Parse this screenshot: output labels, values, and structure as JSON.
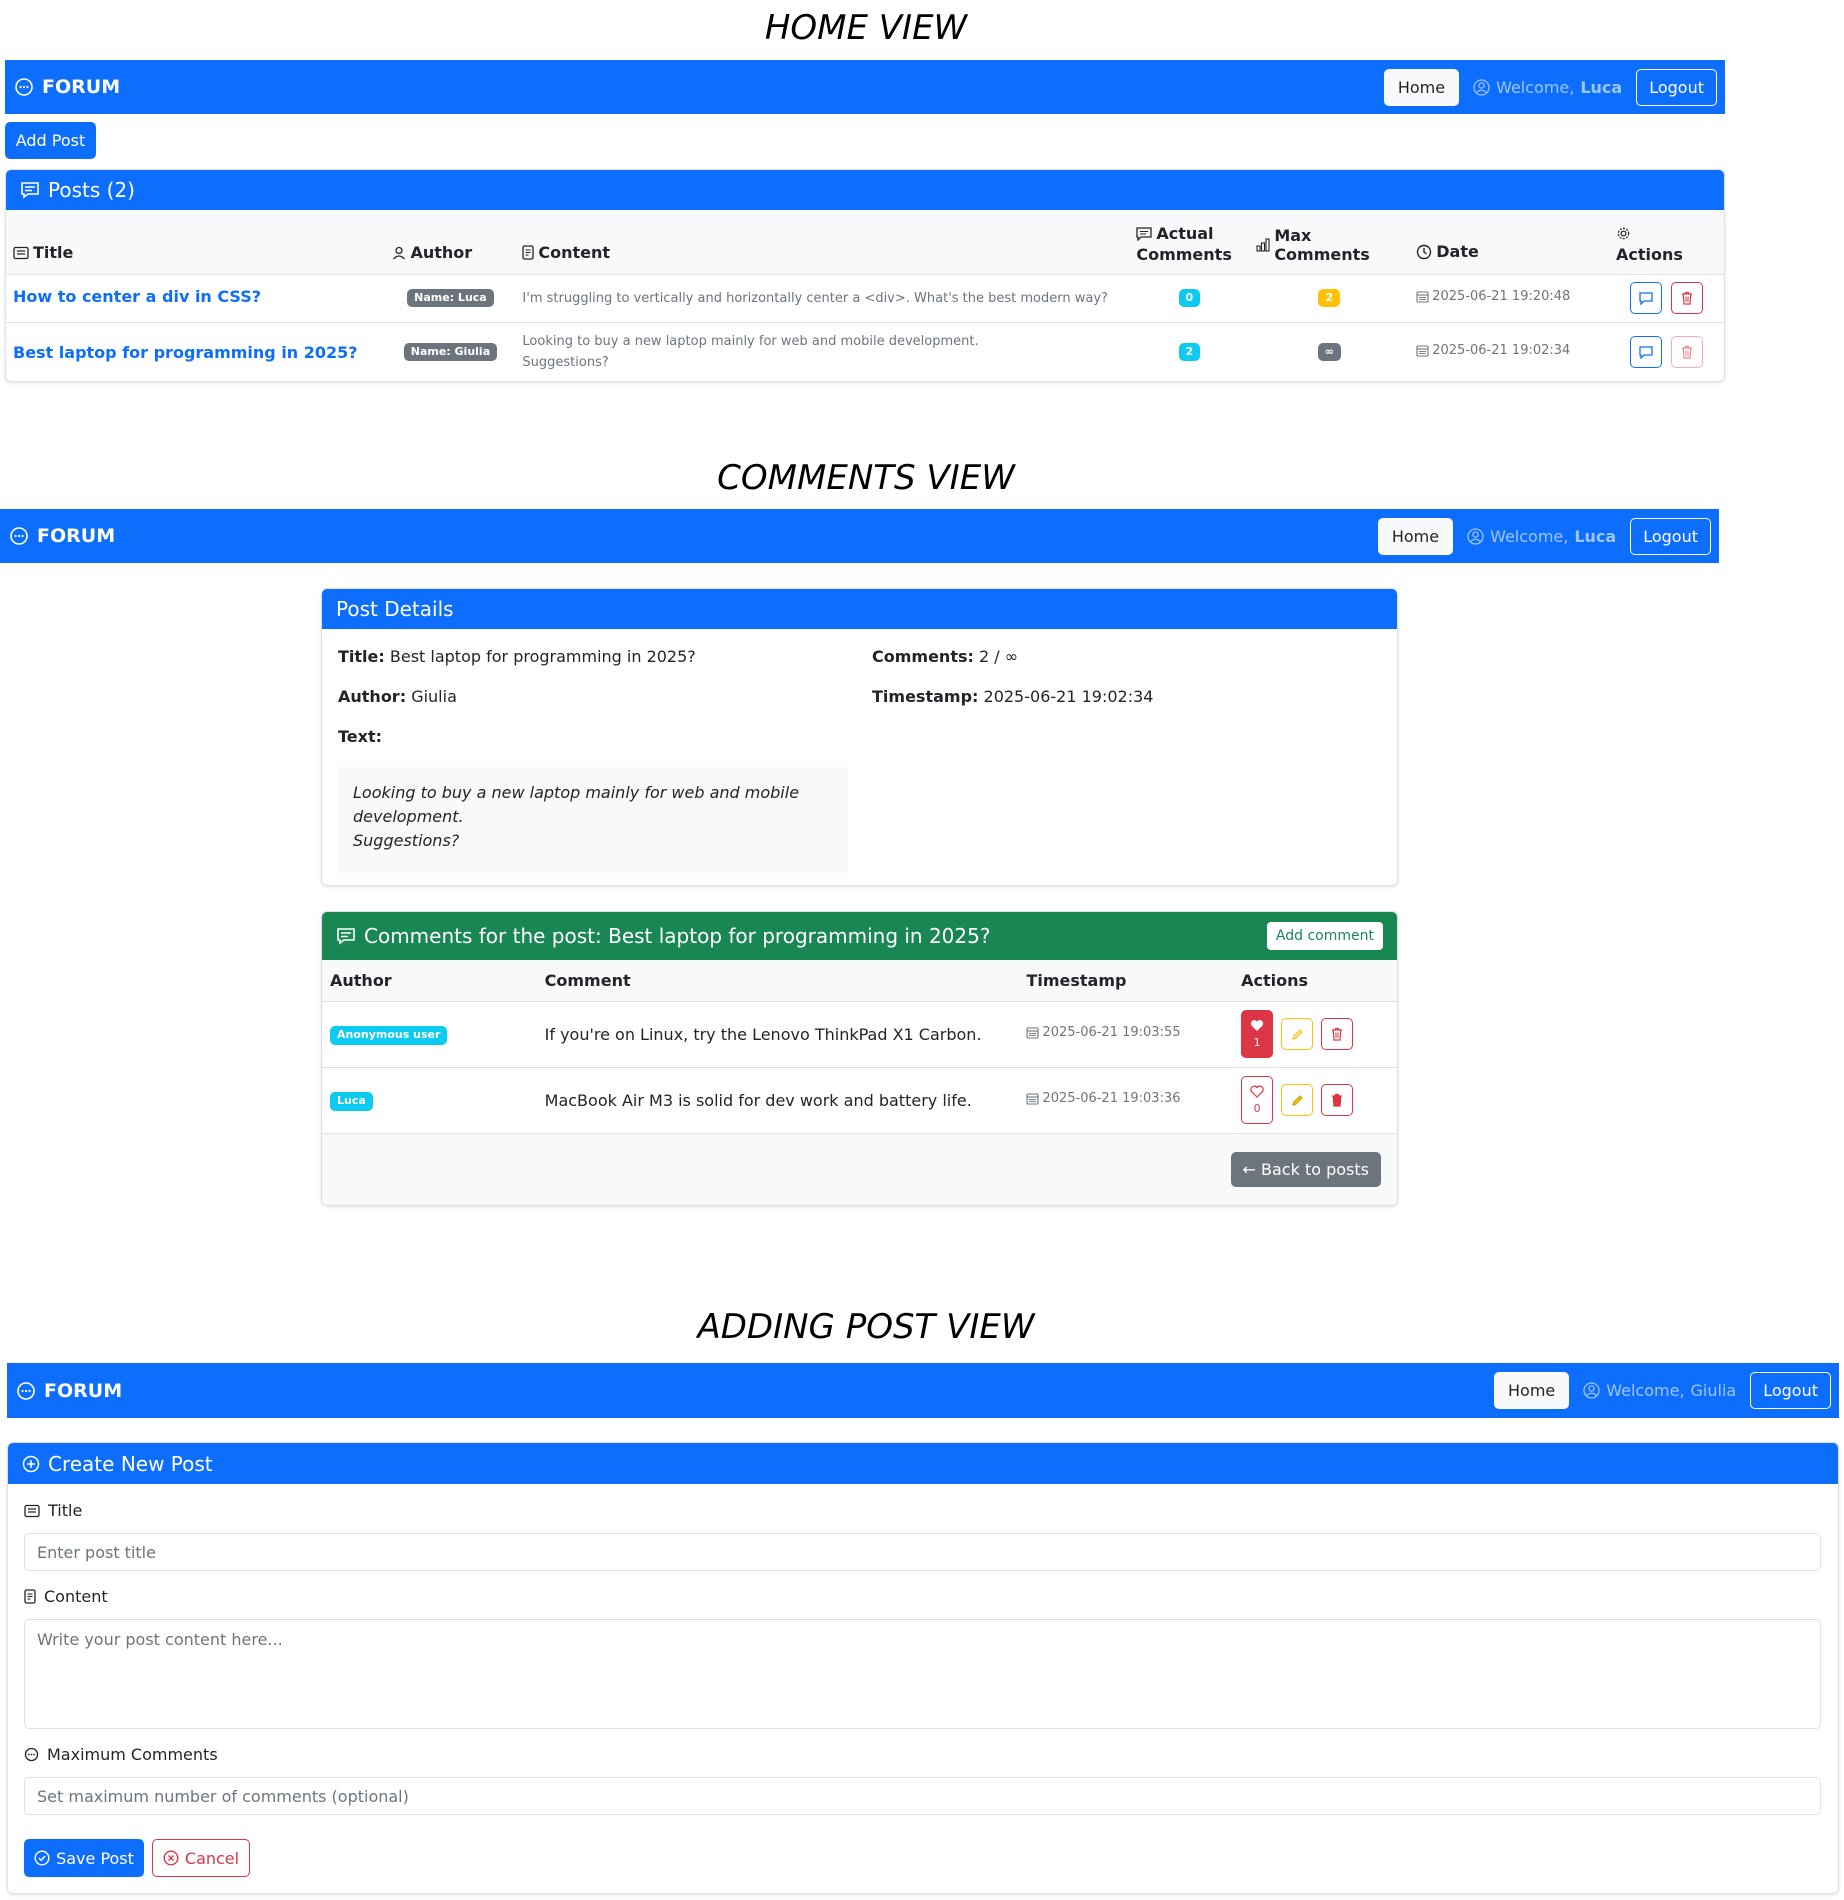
{
  "view_titles": {
    "home": "HOME VIEW",
    "comments": "COMMENTS VIEW",
    "adding": "ADDING POST VIEW"
  },
  "navbar": {
    "brand": "FORUM",
    "home_label": "Home",
    "welcome_prefix": "Welcome,",
    "logout_label": "Logout"
  },
  "home": {
    "user": "Luca",
    "add_post_label": "Add Post",
    "posts_header": "Posts (2)",
    "columns": {
      "title": "Title",
      "author": "Author",
      "content": "Content",
      "actual_comments_1": "Actual",
      "actual_comments_2": "Comments",
      "max_comments": "Max Comments",
      "date": "Date",
      "actions": "Actions"
    },
    "posts": [
      {
        "title": "How to center a div in CSS?",
        "author": "Name: Luca",
        "content": "I'm struggling to vertically and horizontally center a <div>. What's the best modern way?",
        "actual_comments": "0",
        "max_comments": "2",
        "date": "2025-06-21 19:20:48"
      },
      {
        "title": "Best laptop for programming in 2025?",
        "author": "Name: Giulia",
        "content_line1": "Looking to buy a new laptop mainly for web and mobile development.",
        "content_line2": "Suggestions?",
        "actual_comments": "2",
        "max_comments": "∞",
        "date": "2025-06-21 19:02:34"
      }
    ]
  },
  "comments_view": {
    "user": "Luca",
    "details_header": "Post Details",
    "title_label": "Title:",
    "title_value": "Best laptop for programming in 2025?",
    "author_label": "Author:",
    "author_value": "Giulia",
    "text_label": "Text:",
    "text_line1": "Looking to buy a new laptop mainly for web and mobile",
    "text_line2": "development.",
    "text_line3": "Suggestions?",
    "comments_label": "Comments:",
    "comments_value": "2 / ∞",
    "timestamp_label": "Timestamp:",
    "timestamp_value": "2025-06-21 19:02:34",
    "comments_header": "Comments for the post: Best laptop for programming in 2025?",
    "add_comment_label": "Add comment",
    "columns": {
      "author": "Author",
      "comment": "Comment",
      "timestamp": "Timestamp",
      "actions": "Actions"
    },
    "comments": [
      {
        "author": "Anonymous user",
        "text": "If you're on Linux, try the Lenovo ThinkPad X1 Carbon.",
        "timestamp": "2025-06-21 19:03:55",
        "likes": "1"
      },
      {
        "author": "Luca",
        "text": "MacBook Air M3 is solid for dev work and battery life.",
        "timestamp": "2025-06-21 19:03:36",
        "likes": "0"
      }
    ],
    "back_label": "← Back to posts"
  },
  "adding_view": {
    "user": "Giulia",
    "header": "Create New Post",
    "title_label": "Title",
    "title_placeholder": "Enter post title",
    "content_label": "Content",
    "content_placeholder": "Write your post content here...",
    "max_label": "Maximum Comments",
    "max_placeholder": "Set maximum number of comments (optional)",
    "save_label": "Save Post",
    "cancel_label": "Cancel"
  },
  "colors": {
    "primary": "#0d6efd",
    "success": "#198754",
    "danger": "#dc3545",
    "warning": "#ffc107",
    "info": "#0dcaf0",
    "secondary": "#6c757d"
  }
}
